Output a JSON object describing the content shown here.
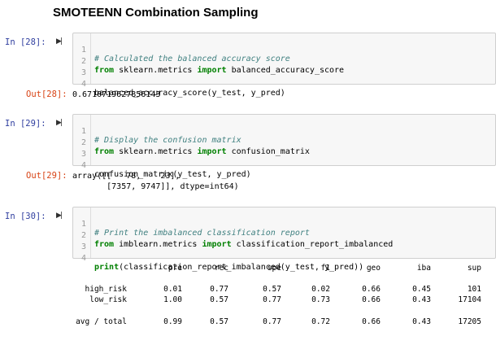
{
  "heading": "SMOTEENN Combination Sampling",
  "cells": [
    {
      "in_prompt": "In [28]:",
      "lines": [
        {
          "n": "1",
          "comment": "# Calculated the balanced accuracy score"
        },
        {
          "n": "2",
          "kw1": "from",
          "mid": " sklearn.metrics ",
          "kw2": "import",
          "rest": " balanced_accuracy_score"
        },
        {
          "n": "3"
        },
        {
          "n": "4",
          "plain": "balanced_accuracy_score(y_test, y_pred)"
        }
      ],
      "out_prompt": "Out[28]:",
      "output": "0.6710719627856143"
    },
    {
      "in_prompt": "In [29]:",
      "lines": [
        {
          "n": "1",
          "comment": "# Display the confusion matrix"
        },
        {
          "n": "2",
          "kw1": "from",
          "mid": " sklearn.metrics ",
          "kw2": "import",
          "rest": " confusion_matrix"
        },
        {
          "n": "3"
        },
        {
          "n": "4",
          "plain": "confusion_matrix(y_test, y_pred)"
        }
      ],
      "out_prompt": "Out[29]:",
      "output_lines": [
        "array([[   78,    23],",
        "       [7357, 9747]], dtype=int64)"
      ]
    },
    {
      "in_prompt": "In [30]:",
      "lines": [
        {
          "n": "1",
          "comment": "# Print the imbalanced classification report"
        },
        {
          "n": "2",
          "kw1": "from",
          "mid": " imblearn.metrics ",
          "kw2": "import",
          "rest": " classification_report_imbalanced"
        },
        {
          "n": "3"
        },
        {
          "n": "4",
          "kw1": "print",
          "rest": "(classification_report_imbalanced(y_test, y_pred))"
        }
      ]
    }
  ],
  "report": {
    "columns": [
      "pre",
      "rec",
      "spe",
      "f1",
      "geo",
      "iba",
      "sup"
    ],
    "rows": [
      {
        "label": "high_risk",
        "values": [
          "0.01",
          "0.77",
          "0.57",
          "0.02",
          "0.66",
          "0.45",
          "101"
        ]
      },
      {
        "label": "low_risk",
        "values": [
          "1.00",
          "0.57",
          "0.77",
          "0.73",
          "0.66",
          "0.43",
          "17104"
        ]
      },
      {
        "label": "avg / total",
        "values": [
          "0.99",
          "0.57",
          "0.77",
          "0.72",
          "0.66",
          "0.43",
          "17205"
        ]
      }
    ]
  }
}
